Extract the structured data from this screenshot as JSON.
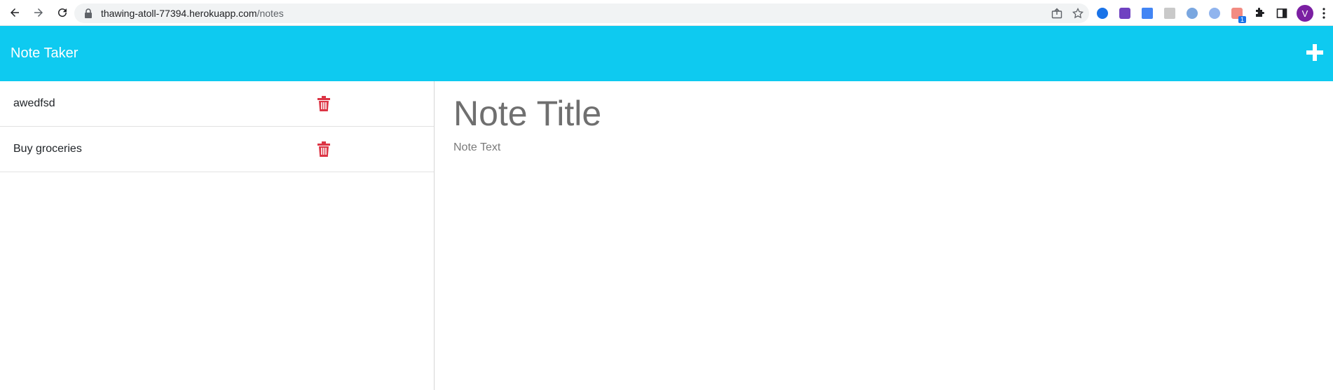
{
  "browser": {
    "url_host": "thawing-atoll-77394.herokuapp.com",
    "url_path": "/notes",
    "avatar_letter": "V",
    "extension_badge": "1"
  },
  "app": {
    "title": "Note Taker",
    "accent_color": "#0ecaf0",
    "delete_color": "#dc3545"
  },
  "notes": [
    {
      "title": "awedfsd"
    },
    {
      "title": "Buy groceries"
    }
  ],
  "editor": {
    "title_placeholder": "Note Title",
    "text_placeholder": "Note Text"
  },
  "icons": {
    "back": "arrow-left-icon",
    "forward": "arrow-right-icon",
    "reload": "reload-icon",
    "lock": "lock-icon",
    "share": "share-icon",
    "bookmark": "star-icon",
    "extensions": "puzzle-icon",
    "sidepanel": "side-panel-icon",
    "menu": "kebab-menu-icon",
    "new_note": "plus-icon",
    "delete": "trash-icon"
  }
}
